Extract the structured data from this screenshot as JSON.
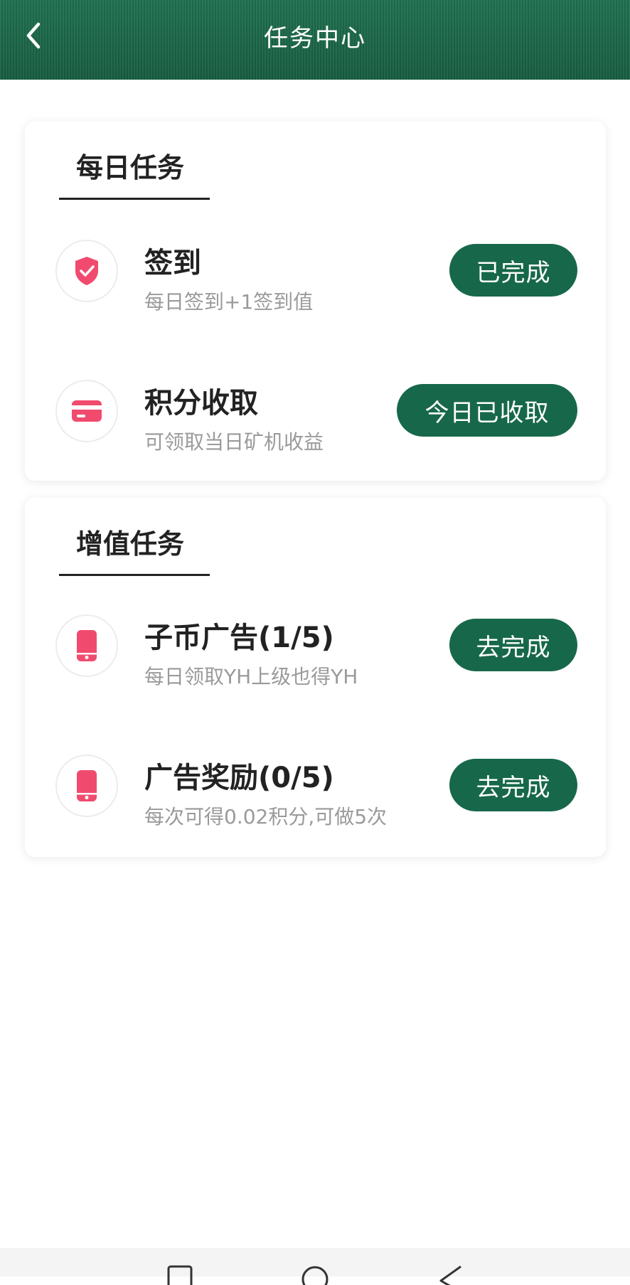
{
  "header": {
    "title": "任务中心",
    "back_icon": "chevron-left-icon",
    "bg_color": "#1d6a4a"
  },
  "sections": [
    {
      "title": "每日任务",
      "tasks": [
        {
          "name": "签到",
          "desc": "每日签到+1签到值",
          "button": "已完成",
          "icon": "shield-check-icon"
        },
        {
          "name": "积分收取",
          "desc": "可领取当日矿机收益",
          "button": "今日已收取",
          "icon": "card-icon"
        }
      ]
    },
    {
      "title": "增值任务",
      "tasks": [
        {
          "name": "子币广告(1/5)",
          "desc": "每日领取YH上级也得YH",
          "button": "去完成",
          "icon": "phone-icon"
        },
        {
          "name": "广告奖励(0/5)",
          "desc": "每次可得0.02积分,可做5次",
          "button": "去完成",
          "icon": "phone-icon"
        }
      ]
    }
  ],
  "colors": {
    "accent": "#17684a",
    "icon": "#f04b6e",
    "title_text": "#222222",
    "desc_text": "#9a9a9a"
  },
  "system_nav": {
    "icons": [
      "square-icon",
      "circle-icon",
      "triangle-back-icon"
    ]
  }
}
